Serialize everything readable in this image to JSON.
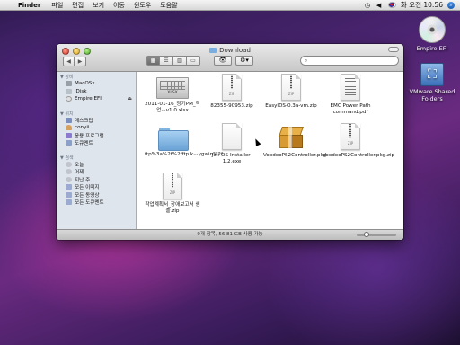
{
  "menubar": {
    "app": "Finder",
    "items": [
      "파일",
      "편집",
      "보기",
      "이동",
      "윈도우",
      "도움말"
    ],
    "clock": "화 오전 10:56"
  },
  "window": {
    "title": "Download",
    "search_placeholder": "",
    "status": "9개 항목, 56.81 GB 사용 가능"
  },
  "sidebar": {
    "sections": [
      {
        "header": "▼ 장비",
        "items": [
          "MacOSx",
          "iDisk",
          "Empire EFI"
        ]
      },
      {
        "header": "▼ 위치",
        "items": [
          "데스크탑",
          "conyii",
          "응용 프로그램",
          "도큐멘트"
        ]
      },
      {
        "header": "▼ 검색",
        "items": [
          "오늘",
          "어제",
          "지난 주",
          "모든 이미지",
          "모든 동영상",
          "모든 도큐멘트"
        ]
      }
    ]
  },
  "files": [
    {
      "label": "2011-01-16_정기PM_작업···v1.0.xlsx",
      "kind": "xlsx",
      "tag": "XLSX"
    },
    {
      "label": "82355-90953.zip",
      "kind": "zip",
      "tag": "ZIP"
    },
    {
      "label": "EasyIDS-0.3a-vm.zip",
      "kind": "zip",
      "tag": "ZIP"
    },
    {
      "label": "EMC Power Path command.pdf",
      "kind": "pdf",
      "tag": ""
    },
    {
      "label": "ftp%3a%2f%2fftp.k···ygwin%2f",
      "kind": "folder",
      "tag": ""
    },
    {
      "label": "Joli-OS-Installer-1.2.exe",
      "kind": "exe",
      "tag": ""
    },
    {
      "label": "VoodooPS2Controller.pkg",
      "kind": "pkg",
      "tag": ""
    },
    {
      "label": "VoodooPS2Controller.pkg.zip",
      "kind": "zip",
      "tag": "ZIP"
    },
    {
      "label": "작업계획서_장애보고서 샘플.zip",
      "kind": "zip",
      "tag": "ZIP"
    }
  ],
  "desktop": [
    {
      "label": "Empire EFI",
      "icon": "cd-icon"
    },
    {
      "label": "VMware Shared Folders",
      "icon": "shared-folder-icon"
    }
  ]
}
